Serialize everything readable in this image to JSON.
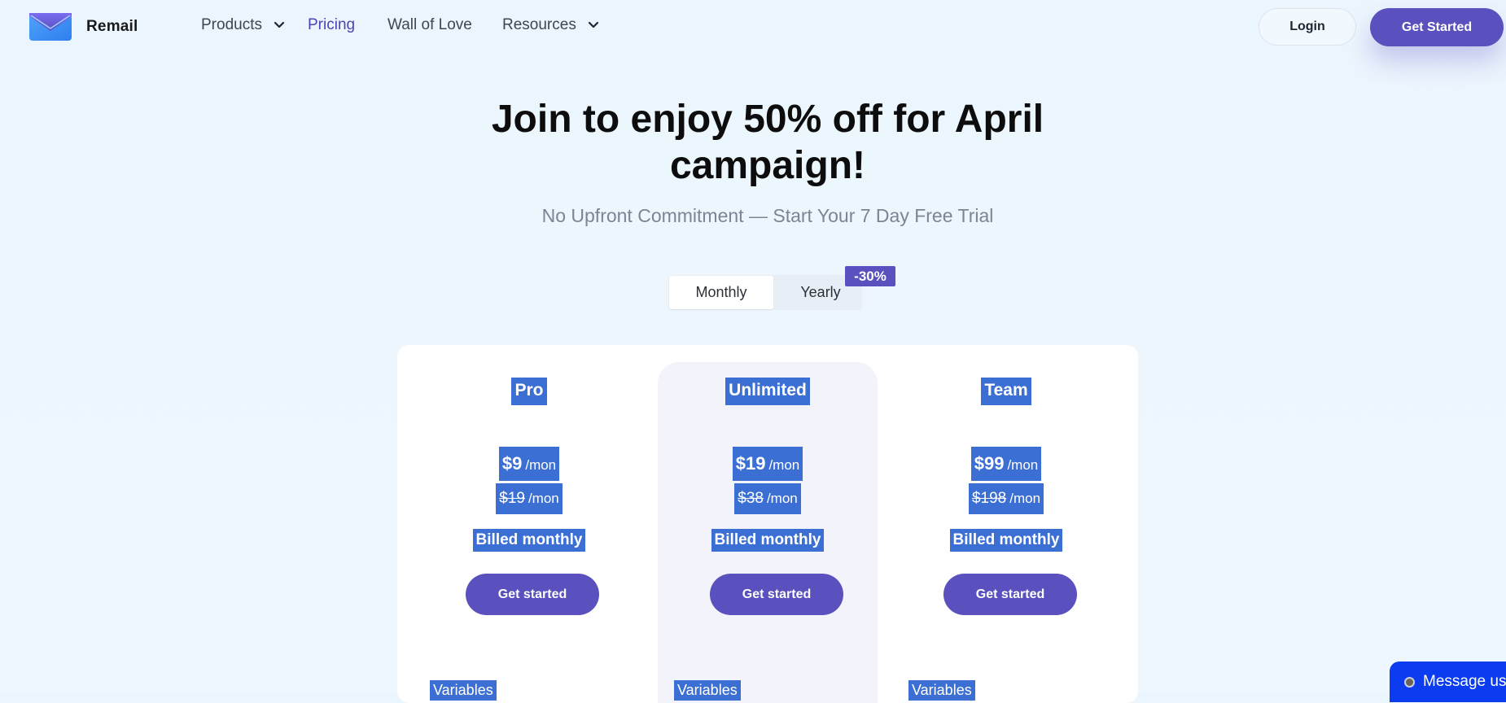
{
  "header": {
    "brand": "Remail",
    "nav": [
      {
        "label": "Products",
        "has_dropdown": true,
        "active": false
      },
      {
        "label": "Pricing",
        "has_dropdown": false,
        "active": true
      },
      {
        "label": "Wall of Love",
        "has_dropdown": false,
        "active": false
      },
      {
        "label": "Resources",
        "has_dropdown": true,
        "active": false
      }
    ],
    "login_label": "Login",
    "get_started_label": "Get Started"
  },
  "hero": {
    "title_line1": "Join to enjoy 50% off for April",
    "title_line2": "campaign!",
    "subtitle": "No Upfront Commitment — Start Your 7 Day Free Trial"
  },
  "billing_toggle": {
    "monthly_label": "Monthly",
    "yearly_label": "Yearly",
    "selected": "Monthly",
    "discount_badge": "-30%"
  },
  "plans": [
    {
      "name": "Pro",
      "price": "$9",
      "per": "/mon",
      "old_price": "$19",
      "billed": "Billed monthly",
      "cta": "Get started",
      "feature": "Variables"
    },
    {
      "name": "Unlimited",
      "price": "$19",
      "per": "/mon",
      "old_price": "$38",
      "billed": "Billed monthly",
      "cta": "Get started",
      "feature": "Variables"
    },
    {
      "name": "Team",
      "price": "$99",
      "per": "/mon",
      "old_price": "$198",
      "billed": "Billed monthly",
      "cta": "Get started",
      "feature": "Variables"
    }
  ],
  "message_widget": {
    "label": "Message us"
  },
  "colors": {
    "accent": "#5a50be",
    "selection": "#3b6fd4",
    "chat_widget": "#0b3cf0",
    "background": "#eaf5fd"
  },
  "icons": {
    "logo": "envelope-logo-icon",
    "dropdown": "chevron-down-icon",
    "chat": "chat-status-dot-icon"
  }
}
